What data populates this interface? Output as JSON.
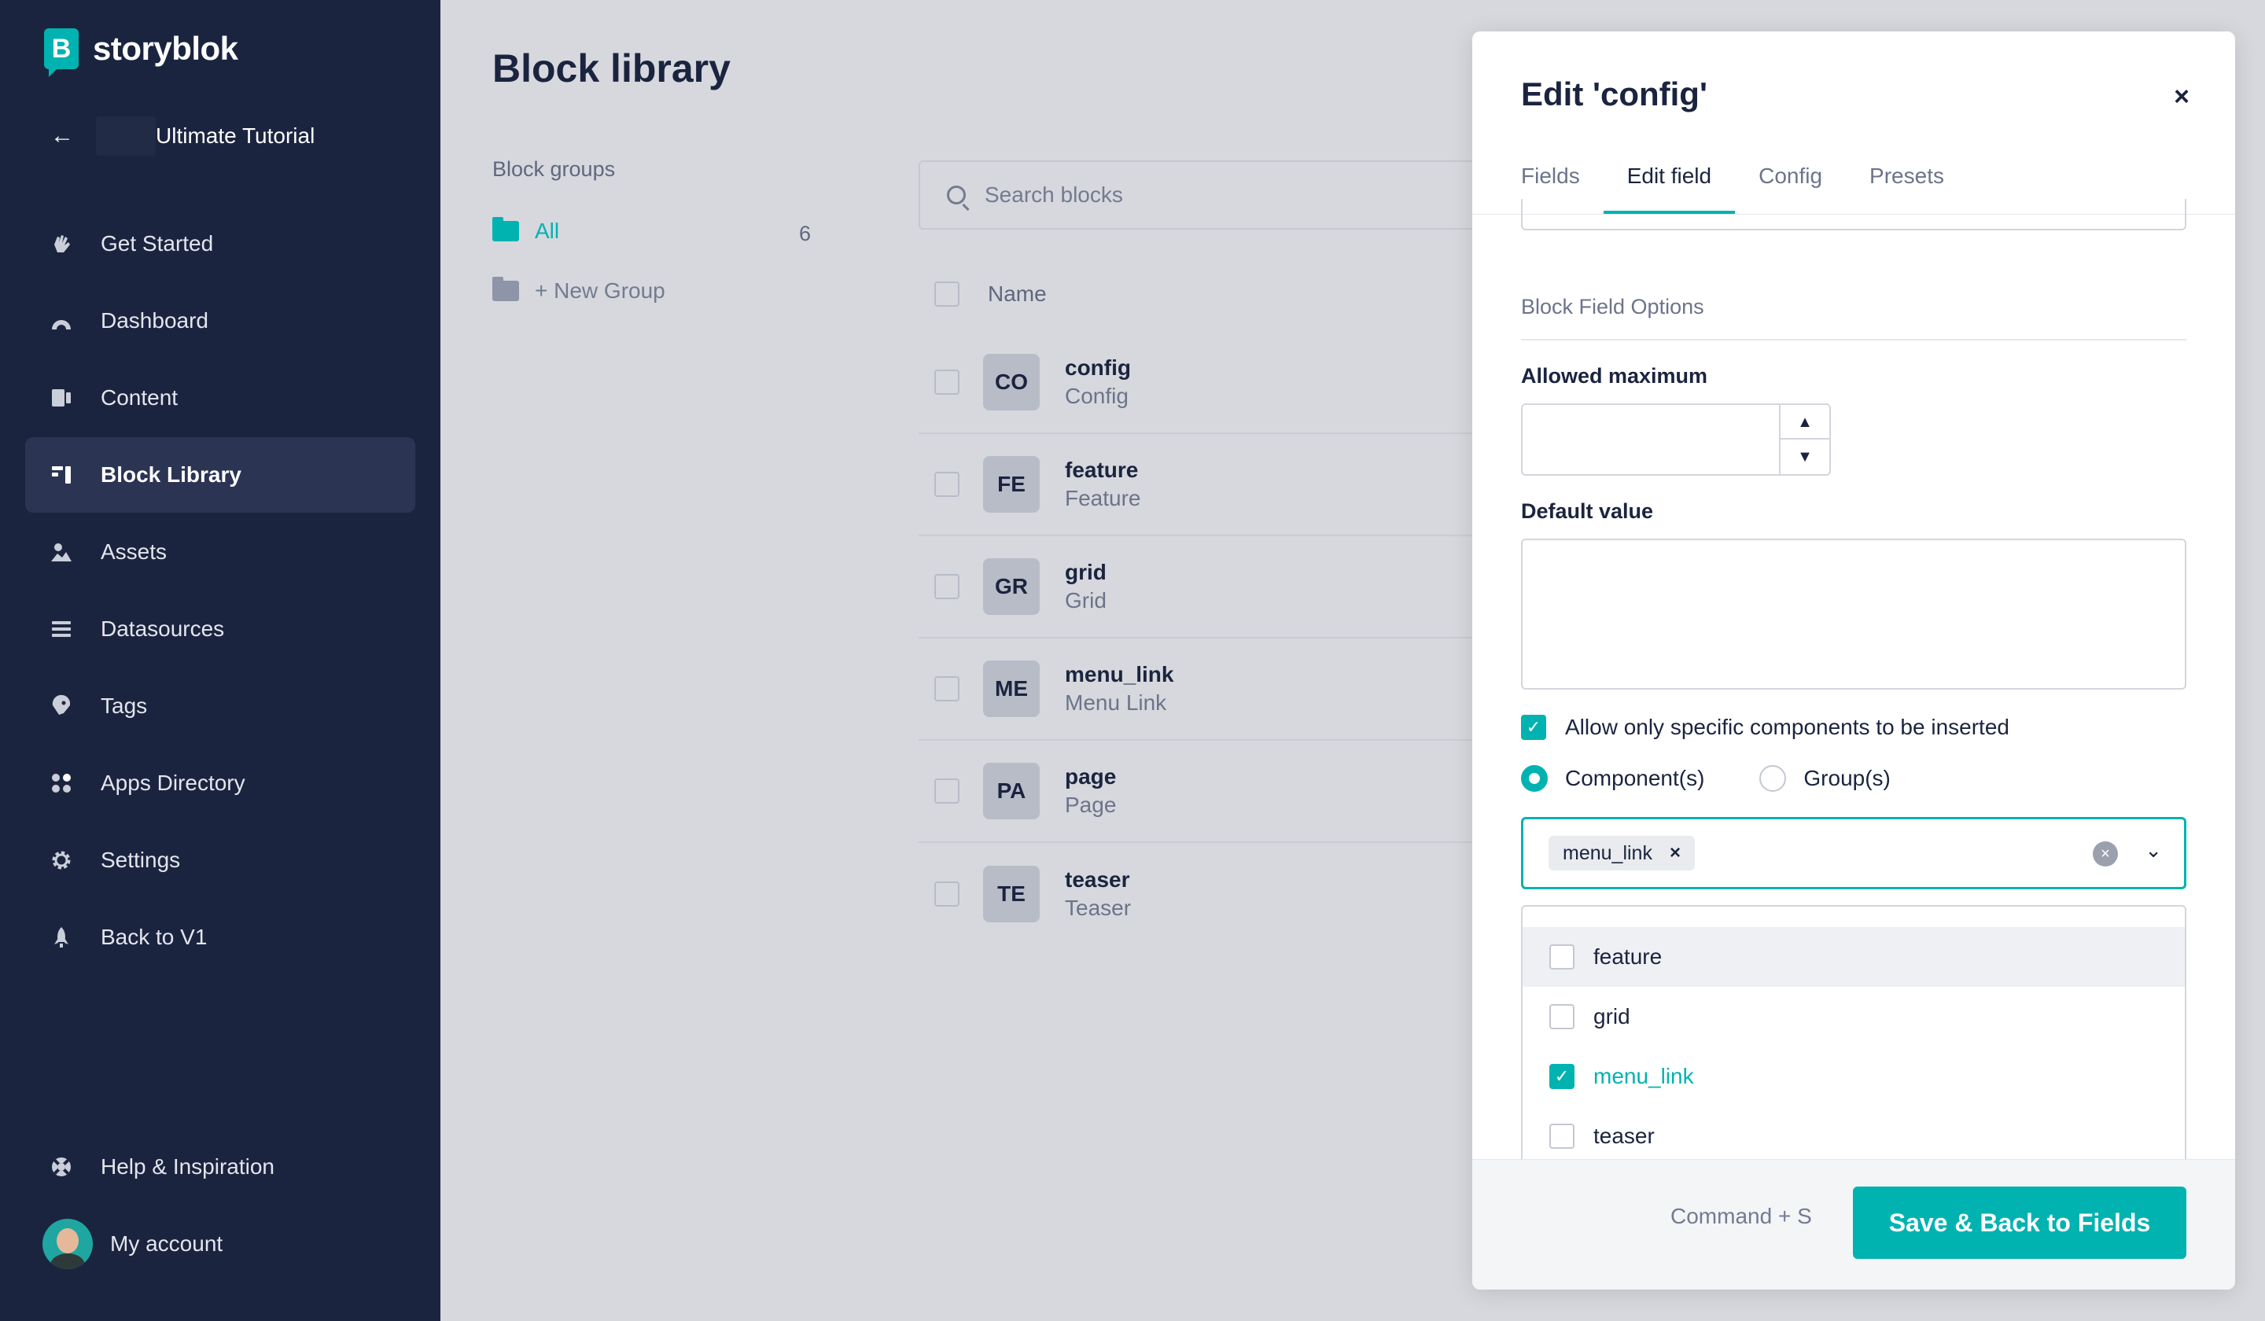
{
  "brand": {
    "name": "storyblok",
    "logo_letter": "B",
    "accent": "#00b3b0",
    "sidebar_bg": "#1b243f"
  },
  "space": {
    "name": "Ultimate Tutorial"
  },
  "sidebar": {
    "items": [
      {
        "label": "Get Started",
        "icon": "waving-hand-icon"
      },
      {
        "label": "Dashboard",
        "icon": "gauge-icon"
      },
      {
        "label": "Content",
        "icon": "content-icon"
      },
      {
        "label": "Block Library",
        "icon": "block-library-icon",
        "active": true
      },
      {
        "label": "Assets",
        "icon": "image-icon"
      },
      {
        "label": "Datasources",
        "icon": "list-icon"
      },
      {
        "label": "Tags",
        "icon": "tag-icon"
      },
      {
        "label": "Apps Directory",
        "icon": "apps-icon"
      },
      {
        "label": "Settings",
        "icon": "gear-icon"
      },
      {
        "label": "Back to V1",
        "icon": "rocket-icon"
      }
    ],
    "bottom": {
      "help": "Help & Inspiration",
      "account": "My account"
    }
  },
  "main": {
    "title": "Block library",
    "groups_label": "Block groups",
    "groups": [
      {
        "label": "All",
        "count": "6"
      }
    ],
    "new_group": "+ New Group",
    "search": {
      "placeholder": "Search blocks"
    },
    "column_name": "Name",
    "blocks": [
      {
        "badge": "CO",
        "name": "config",
        "display": "Config"
      },
      {
        "badge": "FE",
        "name": "feature",
        "display": "Feature"
      },
      {
        "badge": "GR",
        "name": "grid",
        "display": "Grid"
      },
      {
        "badge": "ME",
        "name": "menu_link",
        "display": "Menu Link"
      },
      {
        "badge": "PA",
        "name": "page",
        "display": "Page"
      },
      {
        "badge": "TE",
        "name": "teaser",
        "display": "Teaser"
      }
    ]
  },
  "panel": {
    "title": "Edit 'config'",
    "close": "×",
    "tabs": [
      "Fields",
      "Edit field",
      "Config",
      "Presets"
    ],
    "active_tab": "Edit field",
    "section_title": "Block Field Options",
    "allowed_maximum_label": "Allowed maximum",
    "allowed_maximum_value": "",
    "default_value_label": "Default value",
    "allow_specific_label": "Allow only specific components to be inserted",
    "allow_specific_checked": true,
    "radio_options": [
      "Component(s)",
      "Group(s)"
    ],
    "radio_selected": "Component(s)",
    "selected_chip": "menu_link",
    "options": [
      {
        "label": "feature",
        "checked": false
      },
      {
        "label": "grid",
        "checked": false
      },
      {
        "label": "menu_link",
        "checked": true
      },
      {
        "label": "teaser",
        "checked": false
      }
    ],
    "shortcut": "Command + S",
    "save_label": "Save & Back to Fields"
  }
}
